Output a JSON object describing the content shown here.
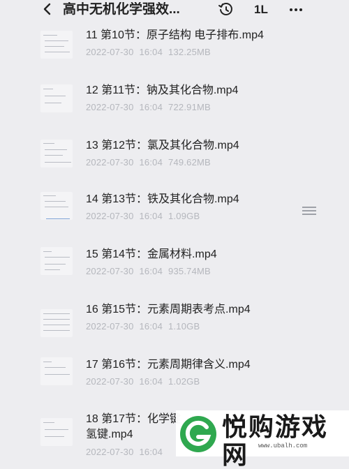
{
  "header": {
    "title": "高中无机化学强效...",
    "sort_label": "1L",
    "icons": [
      "back-arrow-icon",
      "history-icon",
      "sort-icon",
      "more-icon"
    ]
  },
  "files": [
    {
      "name": "11 第10节：原子结构 电子排布.mp4",
      "date": "2022-07-30",
      "time": "16:04",
      "size": "132.25MB"
    },
    {
      "name": "12 第11节：钠及其化合物.mp4",
      "date": "2022-07-30",
      "time": "16:04",
      "size": "722.91MB"
    },
    {
      "name": "13 第12节：氯及其化合物.mp4",
      "date": "2022-07-30",
      "time": "16:04",
      "size": "749.62MB"
    },
    {
      "name": "14 第13节：铁及其化合物.mp4",
      "date": "2022-07-30",
      "time": "16:04",
      "size": "1.09GB"
    },
    {
      "name": "15 第14节：金属材料.mp4",
      "date": "2022-07-30",
      "time": "16:04",
      "size": "935.74MB"
    },
    {
      "name": "16 第15节：元素周期表考点.mp4",
      "date": "2022-07-30",
      "time": "16:04",
      "size": "1.10GB"
    },
    {
      "name": "17 第16节：元素周期律含义.mp4",
      "date": "2022-07-30",
      "time": "16:04",
      "size": "1.02GB"
    },
    {
      "name": "18 第17节：化学键 氢键.mp4",
      "date": "2022-07-30",
      "time": "16:04",
      "size": ""
    }
  ],
  "watermark": {
    "text": "悦购游戏网",
    "url": "www.ubalh.com"
  },
  "colors": {
    "background": "#ededf0",
    "text": "#222222",
    "meta": "#b5b7bd",
    "brand_green": "#2fa84f"
  }
}
